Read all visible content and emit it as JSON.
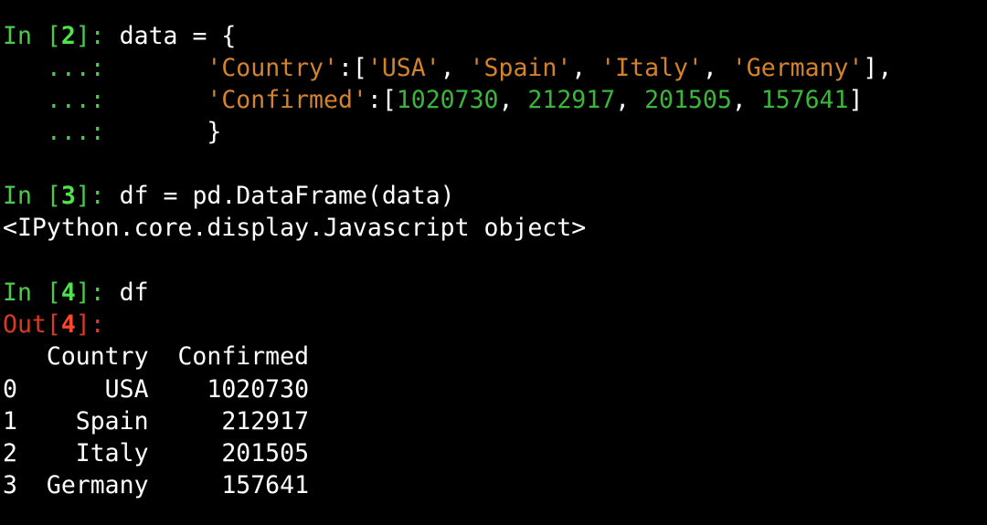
{
  "colors": {
    "background": "#000000",
    "prompt_in": "#4ec94e",
    "prompt_out": "#d93a22",
    "string": "#d2832c",
    "number": "#3bb53b",
    "text": "#ffffff"
  },
  "cells": [
    {
      "prompt": {
        "prefix": "In [",
        "number": "2",
        "suffix": "]: "
      },
      "lines": [
        {
          "code_start": "data = {"
        },
        {
          "cont": "   ...: ",
          "indent": "      ",
          "key": "'Country'",
          "open": ":[",
          "items": [
            "'USA'",
            "'Spain'",
            "'Italy'",
            "'Germany'"
          ],
          "close": "],"
        },
        {
          "cont": "   ...: ",
          "indent": "      ",
          "key": "'Confirmed'",
          "open": ":[",
          "items": [
            "1020730",
            "212917",
            "201505",
            "157641"
          ],
          "close": "]"
        },
        {
          "cont": "   ...: ",
          "indent": "      ",
          "text": "}"
        }
      ]
    },
    {
      "prompt": {
        "prefix": "In [",
        "number": "3",
        "suffix": "]: "
      },
      "code": "df = pd.DataFrame(data)",
      "output": "<IPython.core.display.Javascript object>"
    },
    {
      "prompt": {
        "prefix": "In [",
        "number": "4",
        "suffix": "]: "
      },
      "code": "df",
      "out_prompt": {
        "prefix": "Out[",
        "number": "4",
        "suffix": "]:"
      },
      "table": {
        "header": "   Country  Confirmed",
        "rows": [
          "0      USA    1020730",
          "1    Spain     212917",
          "2    Italy     201505",
          "3  Germany     157641"
        ]
      }
    }
  ]
}
